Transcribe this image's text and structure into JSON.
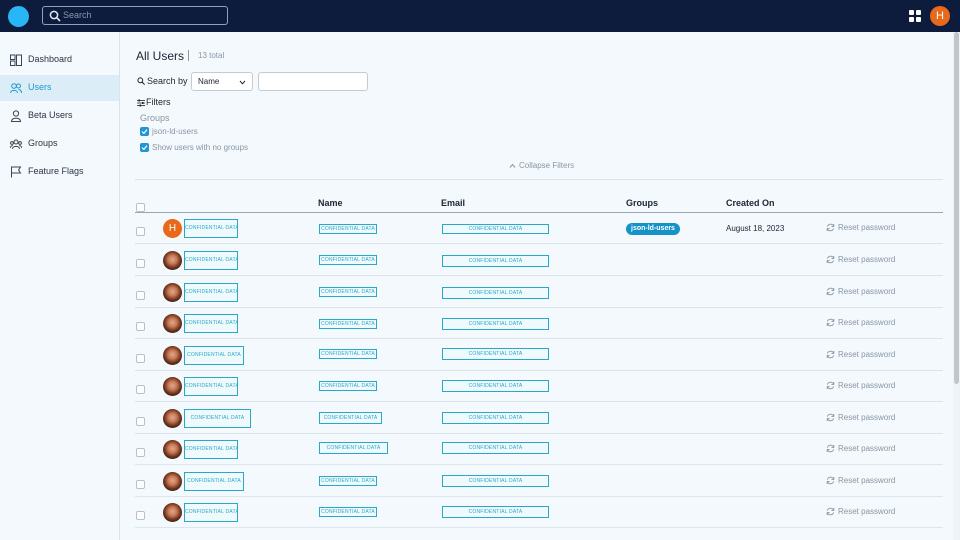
{
  "search": {
    "placeholder": "Search"
  },
  "top_user_initial": "H",
  "sidebar": {
    "items": [
      {
        "label": "Dashboard",
        "icon": "dashboard-icon"
      },
      {
        "label": "Users",
        "icon": "users-icon",
        "active": true
      },
      {
        "label": "Beta Users",
        "icon": "user-icon"
      },
      {
        "label": "Groups",
        "icon": "groups-icon"
      },
      {
        "label": "Feature Flags",
        "icon": "flag-icon"
      }
    ]
  },
  "main": {
    "title": "All Users",
    "total": "13 total",
    "search_by_label": "Search by",
    "search_by_value": "Name",
    "filters_label": "Filters",
    "groups_label": "Groups",
    "filter_options": [
      {
        "label": "json-ld-users",
        "checked": true
      },
      {
        "label": "Show users with no groups",
        "checked": true
      }
    ],
    "collapse_label": "Collapse Filters"
  },
  "table": {
    "columns": [
      "Name",
      "Email",
      "Groups",
      "Created On"
    ],
    "redacted_text": "CONFIDENTIAL DATA",
    "reset_label": "Reset password",
    "rows": [
      {
        "avatar": "letter",
        "initial": "H",
        "group": "json-ld-users",
        "created": "August 18, 2023"
      },
      {
        "avatar": "photo"
      },
      {
        "avatar": "photo"
      },
      {
        "avatar": "photo"
      },
      {
        "avatar": "photo"
      },
      {
        "avatar": "photo"
      },
      {
        "avatar": "photo"
      },
      {
        "avatar": "photo"
      },
      {
        "avatar": "photo"
      },
      {
        "avatar": "photo"
      }
    ]
  },
  "colors": {
    "topbar": "#0d1b3d",
    "accent": "#2196d3",
    "avatar_orange": "#e8681c",
    "redaction": "#2aa8c8"
  }
}
